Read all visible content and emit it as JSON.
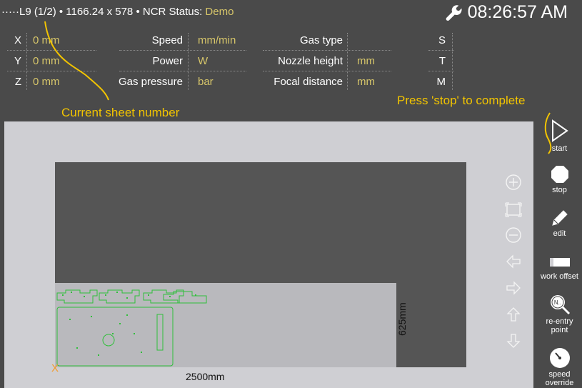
{
  "header": {
    "prefix": "·····L9",
    "sheet": "(1/2)",
    "bullet": "•",
    "sheet_size": "1166.24 x 578",
    "ncr_label": "NCR Status:",
    "ncr_value": "Demo",
    "time": "08:26:57 AM"
  },
  "params": {
    "rows": [
      {
        "axis": "X",
        "axis_value": "0 mm",
        "label2": "Speed",
        "value2": "mm/min",
        "label3": "Gas type",
        "value3": "",
        "code": "S"
      },
      {
        "axis": "Y",
        "axis_value": "0 mm",
        "label2": "Power",
        "value2": "W",
        "label3": "Nozzle height",
        "value3": "mm",
        "code": "T"
      },
      {
        "axis": "Z",
        "axis_value": "0 mm",
        "label2": "Gas pressure",
        "value2": "bar",
        "label3": "Focal distance",
        "value3": "mm",
        "code": "M"
      }
    ]
  },
  "annotations": {
    "sheet_number": "Current sheet number",
    "stop_hint": "Press 'stop' to complete"
  },
  "canvas": {
    "width_label": "2500mm",
    "height_label": "625mm",
    "origin_marker": "X"
  },
  "toolbar": {
    "start": "start",
    "stop": "stop",
    "edit": "edit",
    "work_offset": "work offset",
    "reentry": "re-entry point",
    "reentry_badge": "N..",
    "speed_override": "speed override"
  },
  "colors": {
    "accent_value": "#d7c66a",
    "annotation": "#f2c400",
    "part_outline": "#2fbf3a"
  }
}
